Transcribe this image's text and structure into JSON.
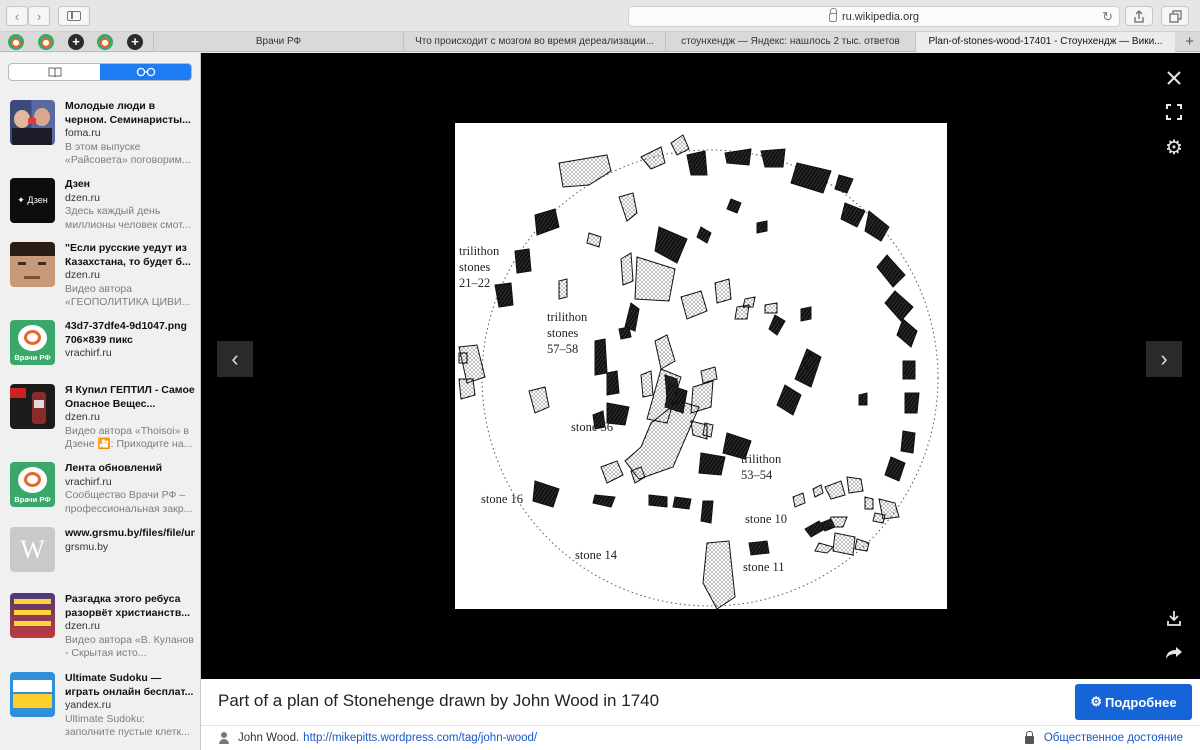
{
  "browser": {
    "url": "ru.wikipedia.org",
    "tabs": [
      {
        "label": "Врачи РФ"
      },
      {
        "label": "Что происходит с мозгом во время дереализации..."
      },
      {
        "label": "стоунхендж — Яндекс: нашлось 2 тыс. ответов"
      },
      {
        "label": "Plan-of-stones-wood-17401 - Стоунхендж — Вики..."
      }
    ]
  },
  "sidebar": {
    "items": [
      {
        "title": "Молодые люди в черном. Семинаристы...",
        "source": "foma.ru",
        "desc": "В этом выпуске «Райсовета» поговорим..."
      },
      {
        "title": "Дзен",
        "source": "dzen.ru",
        "desc": "Здесь каждый день миллионы человек смот..."
      },
      {
        "title": "\"Если русские уедут из Казахстана, то будет б...",
        "source": "dzen.ru",
        "desc": "Видео автора «ГЕОПОЛИТИКА ЦИВИ..."
      },
      {
        "title": "43d7-37dfe4-9d1047.png 706×839 пикс",
        "source": "vrachirf.ru",
        "desc": ""
      },
      {
        "title": "Я Купил ГЕПТИЛ - Самое Опасное Вещес...",
        "source": "dzen.ru",
        "desc": "Видео автора «Thoisoi» в Дзене 🎦: Приходите на..."
      },
      {
        "title": "Лента обновлений",
        "source": "vrachirf.ru",
        "desc": "Сообщество Врачи РФ – профессиональная закр..."
      },
      {
        "title": "www.grsmu.by/files/file/university/cafedry/biolo...",
        "source": "grsmu.by",
        "desc": ""
      },
      {
        "title": "Разгадка этого ребуса разорвёт христианств...",
        "source": "dzen.ru",
        "desc": "Видео автора «В. Куланов - Скрытая исто..."
      },
      {
        "title": "Ultimate Sudoku — играть онлайн бесплат...",
        "source": "yandex.ru",
        "desc": "Ultimate Sudoku: заполните пустые клетк..."
      }
    ],
    "thumb_labels": {
      "dzen": "✦ Дзен",
      "vrachi": "Врачи РФ",
      "w": "W"
    }
  },
  "viewer": {
    "labels": {
      "trilithon_21_22": [
        "trilithon",
        "stones",
        "21–22"
      ],
      "trilithon_57_58": [
        "trilithon",
        "stones",
        "57–58"
      ],
      "stone_56": "stone 56",
      "trilithon_53_54": [
        "trilithon",
        "53–54"
      ],
      "stone_16": "stone 16",
      "stone_10": "stone 10",
      "stone_14": "stone 14",
      "stone_11": "stone 11"
    }
  },
  "caption": {
    "title": "Part of a plan of Stonehenge drawn by John Wood in 1740",
    "more_button": "Подробнее",
    "author": "John Wood.",
    "author_link": "http://mikepitts.wordpress.com/tag/john-wood/",
    "license": "Общественное достояние"
  }
}
